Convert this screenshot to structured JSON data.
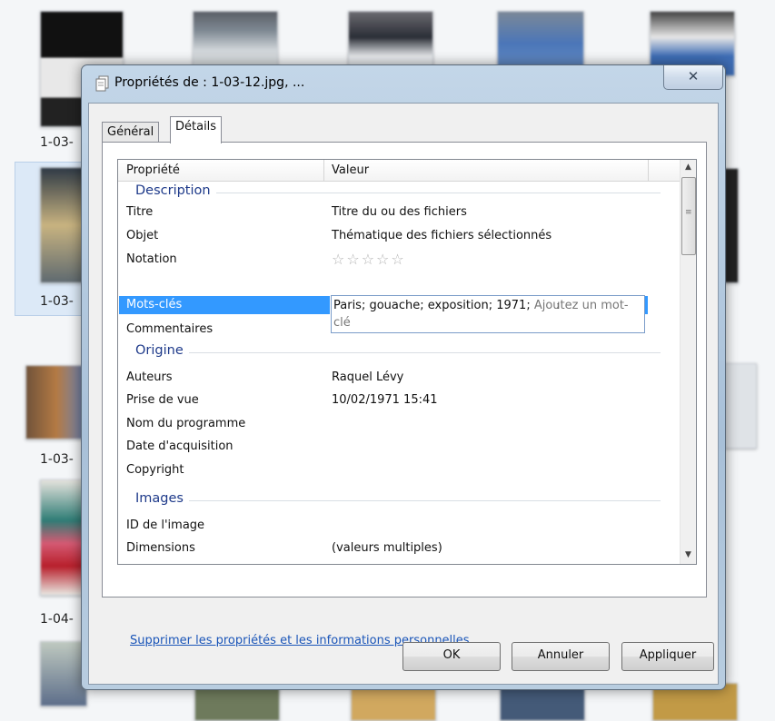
{
  "background": {
    "file_labels": [
      "1-03-",
      "1-03-",
      "1-03-",
      "1-04-"
    ]
  },
  "dialog": {
    "title": "Propriétés de : 1-03-12.jpg, ...",
    "close_glyph": "✕",
    "tabs": [
      {
        "label": "Général",
        "active": false
      },
      {
        "label": "Détails",
        "active": true
      }
    ],
    "list": {
      "columns": [
        "Propriété",
        "Valeur"
      ],
      "groups": [
        {
          "name": "Description",
          "rows": [
            {
              "property": "Titre",
              "value": "Titre du ou des fichiers"
            },
            {
              "property": "Objet",
              "value": "Thématique des fichiers sélectionnés"
            },
            {
              "property": "Notation",
              "value": "",
              "stars": "☆☆☆☆☆"
            },
            {
              "property": "Mots-clés",
              "value": "",
              "selected": true
            },
            {
              "property": "Commentaires",
              "value": ""
            }
          ]
        },
        {
          "name": "Origine",
          "rows": [
            {
              "property": "Auteurs",
              "value": "Raquel Lévy"
            },
            {
              "property": "Prise de vue",
              "value": "10/02/1971 15:41"
            },
            {
              "property": "Nom du programme",
              "value": ""
            },
            {
              "property": "Date d'acquisition",
              "value": ""
            },
            {
              "property": "Copyright",
              "value": ""
            }
          ]
        },
        {
          "name": "Images",
          "rows": [
            {
              "property": "ID de l'image",
              "value": ""
            },
            {
              "property": "Dimensions",
              "value": "(valeurs multiples)"
            }
          ]
        }
      ]
    },
    "keyword_editor": {
      "value": "Paris; gouache; exposition; 1971;",
      "placeholder": "Ajoutez un mot-clé"
    },
    "remove_link": "Supprimer les propriétés et les informations personnelles",
    "buttons": {
      "ok": "OK",
      "cancel": "Annuler",
      "apply": "Appliquer"
    },
    "colors": {
      "selection": "#3399ff",
      "group_text": "#1e3a8a",
      "link": "#1a55b8"
    }
  }
}
